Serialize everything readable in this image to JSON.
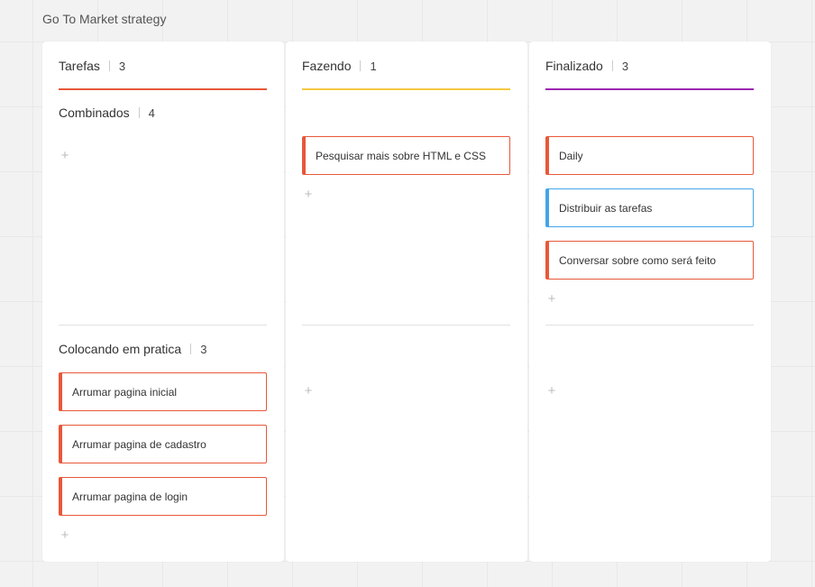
{
  "board": {
    "title": "Go To Market strategy"
  },
  "columns": {
    "tarefas": {
      "title": "Tarefas",
      "count": "3",
      "color": "#e8583a"
    },
    "fazendo": {
      "title": "Fazendo",
      "count": "1",
      "color": "#f5c842"
    },
    "finalizado": {
      "title": "Finalizado",
      "count": "3",
      "color": "#9c27b0"
    }
  },
  "lanes": {
    "combinados": {
      "title": "Combinados",
      "count": "4"
    },
    "colocando": {
      "title": "Colocando em pratica",
      "count": "3"
    }
  },
  "cards": {
    "fazendo_1": "Pesquisar mais sobre HTML e CSS",
    "finalizado_1": "Daily",
    "finalizado_2": "Distribuir as tarefas",
    "finalizado_3": "Conversar sobre como será feito",
    "colocando_1": "Arrumar pagina inicial",
    "colocando_2": "Arrumar pagina de cadastro",
    "colocando_3": "Arrumar pagina de login"
  },
  "card_colors": {
    "default": "#e8583a",
    "blue": "#42a5e8"
  },
  "icons": {
    "add": "plus-icon",
    "add_glyph": "+"
  }
}
